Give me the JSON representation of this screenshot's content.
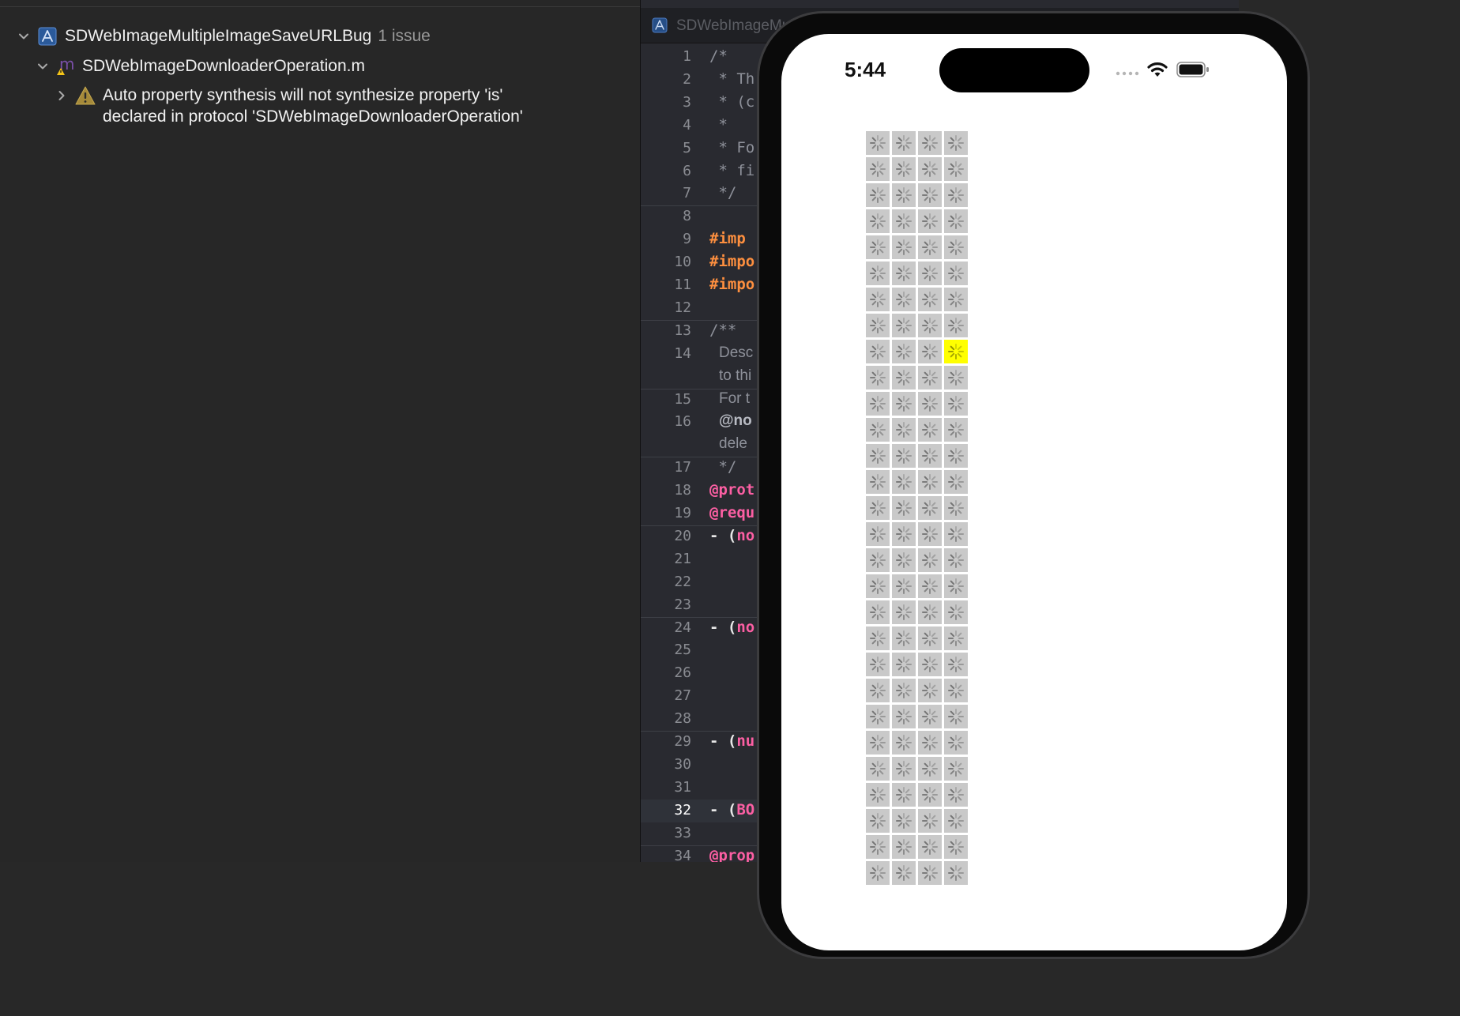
{
  "issue_navigator": {
    "project": {
      "name": "SDWebImageMultipleImageSaveURLBug",
      "count": "1 issue"
    },
    "file": {
      "name": "SDWebImageDownloaderOperation.m"
    },
    "warning": {
      "line1": "Auto property synthesis will not synthesize property 'is'",
      "line2": "declared in protocol 'SDWebImageDownloaderOperation'"
    }
  },
  "editor": {
    "tab_title": "SDWebImageMul",
    "current_line": "32",
    "lines": [
      {
        "n": "1",
        "text": "/*",
        "style": "com"
      },
      {
        "n": "2",
        "text": " * Th",
        "style": "com"
      },
      {
        "n": "3",
        "text": " * (c",
        "style": "com"
      },
      {
        "n": "4",
        "text": " *",
        "style": "com"
      },
      {
        "n": "5",
        "text": " * Fo",
        "style": "com"
      },
      {
        "n": "6",
        "text": " * fi",
        "style": "com"
      },
      {
        "n": "7",
        "text": " */",
        "style": "com"
      },
      {
        "n": "8",
        "text": "",
        "style": "plain"
      },
      {
        "n": "9",
        "text": "#imp",
        "style": "pp"
      },
      {
        "n": "10",
        "text": "#impo",
        "style": "pp"
      },
      {
        "n": "11",
        "text": "#impo",
        "style": "pp"
      },
      {
        "n": "12",
        "text": "",
        "style": "plain"
      },
      {
        "n": "13",
        "text": "/**",
        "style": "com"
      },
      {
        "n": "14",
        "text": "Desc",
        "style": "doc",
        "cont": "to thi"
      },
      {
        "n": "15",
        "text": "For t",
        "style": "doc"
      },
      {
        "n": "16",
        "text": "@no",
        "style": "docb",
        "cont": "dele"
      },
      {
        "n": "17",
        "text": " */",
        "style": "com"
      },
      {
        "n": "18",
        "text": "@prot",
        "style": "kw"
      },
      {
        "n": "19",
        "text": "@requ",
        "style": "kw"
      },
      {
        "n": "20",
        "text": "- (no",
        "style": "method"
      },
      {
        "n": "21",
        "text": "",
        "style": "plain"
      },
      {
        "n": "22",
        "text": "",
        "style": "plain"
      },
      {
        "n": "23",
        "text": "",
        "style": "plain"
      },
      {
        "n": "24",
        "text": "- (no",
        "style": "method"
      },
      {
        "n": "25",
        "text": "",
        "style": "plain"
      },
      {
        "n": "26",
        "text": "",
        "style": "plain"
      },
      {
        "n": "27",
        "text": "",
        "style": "plain"
      },
      {
        "n": "28",
        "text": "",
        "style": "plain"
      },
      {
        "n": "29",
        "text": "- (nu",
        "style": "method"
      },
      {
        "n": "30",
        "text": "",
        "style": "plain"
      },
      {
        "n": "31",
        "text": "",
        "style": "plain"
      },
      {
        "n": "32",
        "text": "- (BO",
        "style": "method"
      },
      {
        "n": "33",
        "text": "",
        "style": "plain"
      },
      {
        "n": "34",
        "text": "@prop",
        "style": "kw"
      }
    ]
  },
  "simulator": {
    "time": "5:44",
    "grid": {
      "columns": 4,
      "rows": 29,
      "highlighted_cell": {
        "row": 9,
        "column": 4
      },
      "highlight_color": "#ffff00",
      "cell_color": "#c9c9c9"
    }
  },
  "colors": {
    "preprocessor": "#fd8f3f",
    "keyword": "#fc5fa3",
    "comment": "#8e919a",
    "warning": "#f5c518"
  },
  "icons": {
    "project": "xcode-project-icon",
    "file": "objc-source-file-icon",
    "warning": "warning-triangle-icon"
  }
}
